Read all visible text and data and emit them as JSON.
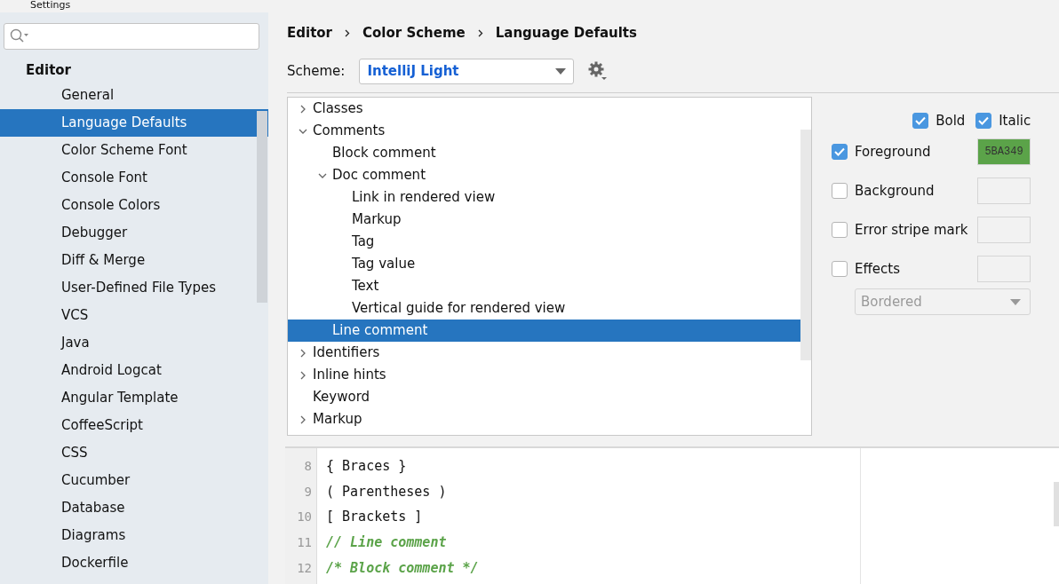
{
  "window": {
    "title": "Settings"
  },
  "sidebar": {
    "heading": "Editor",
    "items": [
      {
        "label": "General",
        "selected": false
      },
      {
        "label": "Language Defaults",
        "selected": true
      },
      {
        "label": "Color Scheme Font",
        "selected": false
      },
      {
        "label": "Console Font",
        "selected": false
      },
      {
        "label": "Console Colors",
        "selected": false
      },
      {
        "label": "Debugger",
        "selected": false
      },
      {
        "label": "Diff & Merge",
        "selected": false
      },
      {
        "label": "User-Defined File Types",
        "selected": false
      },
      {
        "label": "VCS",
        "selected": false
      },
      {
        "label": "Java",
        "selected": false
      },
      {
        "label": "Android Logcat",
        "selected": false
      },
      {
        "label": "Angular Template",
        "selected": false
      },
      {
        "label": "CoffeeScript",
        "selected": false
      },
      {
        "label": "CSS",
        "selected": false
      },
      {
        "label": "Cucumber",
        "selected": false
      },
      {
        "label": "Database",
        "selected": false
      },
      {
        "label": "Diagrams",
        "selected": false
      },
      {
        "label": "Dockerfile",
        "selected": false
      }
    ]
  },
  "breadcrumbs": [
    "Editor",
    "Color Scheme",
    "Language Defaults"
  ],
  "scheme": {
    "label": "Scheme:",
    "value": "IntelliJ Light"
  },
  "tree": [
    {
      "label": "Classes",
      "expanded": false,
      "selected": false
    },
    {
      "label": "Comments",
      "expanded": true,
      "selected": false,
      "children": [
        {
          "label": "Block comment",
          "selected": false
        },
        {
          "label": "Doc comment",
          "expanded": true,
          "selected": false,
          "children": [
            {
              "label": "Link in rendered view",
              "selected": false
            },
            {
              "label": "Markup",
              "selected": false
            },
            {
              "label": "Tag",
              "selected": false
            },
            {
              "label": "Tag value",
              "selected": false
            },
            {
              "label": "Text",
              "selected": false
            },
            {
              "label": "Vertical guide for rendered view",
              "selected": false
            }
          ]
        },
        {
          "label": "Line comment",
          "selected": true
        }
      ]
    },
    {
      "label": "Identifiers",
      "expanded": false,
      "selected": false
    },
    {
      "label": "Inline hints",
      "expanded": false,
      "selected": false
    },
    {
      "label": "Keyword",
      "selected": false
    },
    {
      "label": "Markup",
      "expanded": false,
      "selected": false
    }
  ],
  "font_style": [
    {
      "label": "Bold",
      "checked": true
    },
    {
      "label": "Italic",
      "checked": true
    }
  ],
  "attributes": [
    {
      "label": "Foreground",
      "checked": true,
      "value": "5BA349",
      "color": "#5ba349"
    },
    {
      "label": "Background",
      "checked": false
    },
    {
      "label": "Error stripe mark",
      "checked": false
    },
    {
      "label": "Effects",
      "checked": false
    }
  ],
  "effects_dropdown": {
    "value": "Bordered",
    "disabled": true
  },
  "preview": [
    {
      "number": "8",
      "text": "{ Braces }",
      "kind": "plain"
    },
    {
      "number": "9",
      "text": "( Parentheses )",
      "kind": "plain"
    },
    {
      "number": "10",
      "text": "[ Brackets ]",
      "kind": "plain"
    },
    {
      "number": "11",
      "text": "// Line comment",
      "kind": "comment"
    },
    {
      "number": "12",
      "text": "/* Block comment */",
      "kind": "comment"
    }
  ]
}
